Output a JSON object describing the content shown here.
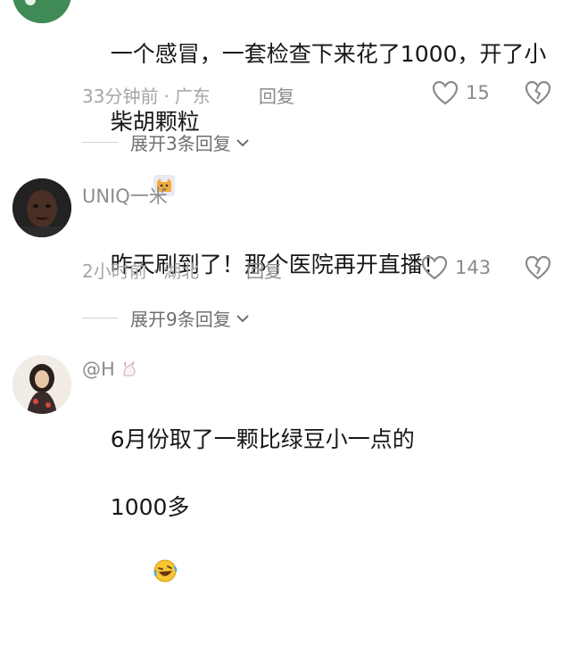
{
  "comments": [
    {
      "username": "",
      "text_line1": "一个感冒，一套检查下来花了1000，开了小",
      "text_line2": "柴胡颗粒",
      "emoji": "cat-sticker-icon",
      "time": "33分钟前",
      "location": "广东",
      "reply_label": "回复",
      "likes": "15",
      "expand_label": "展开3条回复"
    },
    {
      "username": "UNIQ一米",
      "text_line1": "昨天刷到了！那个医院再开直播！",
      "time": "2小时前",
      "location": "湖北",
      "reply_label": "回复",
      "likes": "143",
      "expand_label": "展开9条回复"
    },
    {
      "username": "@H",
      "text_line1": "6月份取了一颗比绿豆小一点的",
      "text_line2": "1000多",
      "emoji": "rolling-laughing-icon",
      "time": "",
      "location": ""
    }
  ],
  "colors": {
    "text": "#171717",
    "meta": "#a6a6a6",
    "username": "#8c8c8c",
    "icon": "#8a8a8a"
  }
}
